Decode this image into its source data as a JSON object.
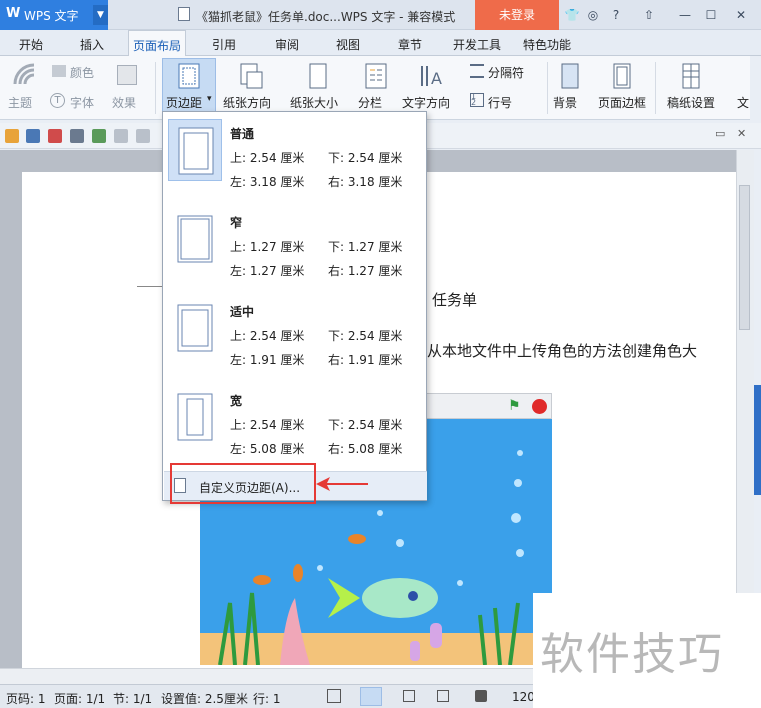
{
  "titlebar": {
    "app_name": "WPS 文字",
    "doc_title": "《猫抓老鼠》任务单.doc...WPS 文字 - 兼容模式",
    "login_label": "未登录"
  },
  "menu": {
    "tabs": [
      "开始",
      "插入",
      "页面布局",
      "引用",
      "审阅",
      "视图",
      "章节",
      "开发工具",
      "特色功能"
    ],
    "active_index": 2
  },
  "ribbon": {
    "theme": "主题",
    "color": "颜色",
    "font": "字体",
    "effect": "效果",
    "margins": "页边距",
    "orientation": "纸张方向",
    "size": "纸张大小",
    "columns": "分栏",
    "text_direction": "文字方向",
    "breaks": "分隔符",
    "line_numbers": "行号",
    "background": "背景",
    "page_border": "页面边框",
    "manuscript": "稿纸设置",
    "more": "文"
  },
  "margin_presets": [
    {
      "name": "普通",
      "top": "上: 2.54 厘米",
      "bottom": "下: 2.54 厘米",
      "left": "左: 3.18 厘米",
      "right": "右: 3.18 厘米",
      "selected": true
    },
    {
      "name": "窄",
      "top": "上: 1.27 厘米",
      "bottom": "下: 1.27 厘米",
      "left": "左: 1.27 厘米",
      "right": "右: 1.27 厘米",
      "selected": false
    },
    {
      "name": "适中",
      "top": "上: 2.54 厘米",
      "bottom": "下: 2.54 厘米",
      "left": "左: 1.91 厘米",
      "right": "右: 1.91 厘米",
      "selected": false
    },
    {
      "name": "宽",
      "top": "上: 2.54 厘米",
      "bottom": "下: 2.54 厘米",
      "left": "左: 5.08 厘米",
      "right": "右: 5.08 厘米",
      "selected": false
    }
  ],
  "custom_margins": "自定义页边距(A)...",
  "document": {
    "heading": "任务单",
    "line": "从本地文件中上传角色的方法创建角色大"
  },
  "statusbar": {
    "page_no": "页码: 1",
    "pages": "页面: 1/1",
    "section": "节: 1/1",
    "setting": "设置值: 2.5厘米",
    "row": "行: 1",
    "zoom": "120"
  },
  "watermark": "软件技巧",
  "colors": {
    "accent": "#2f7fe0",
    "login": "#ef6b4a",
    "highlight": "#e53935"
  }
}
